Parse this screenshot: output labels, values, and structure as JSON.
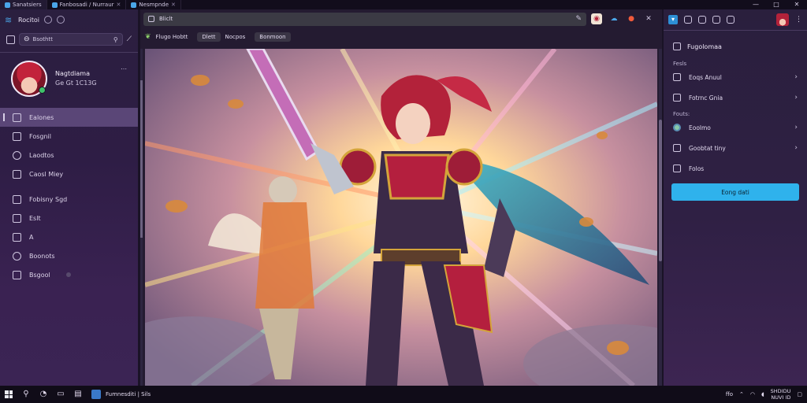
{
  "titlebar": {
    "tabs": [
      {
        "label": "Sanatsiers",
        "active": true
      },
      {
        "label": "Fanbosadi / Nurraur",
        "active": false
      },
      {
        "label": "Nesmpnde",
        "active": false
      }
    ],
    "controls": {
      "minimize": "—",
      "maximize": "□",
      "close": "✕"
    }
  },
  "sidebar": {
    "title": "Rocitoi",
    "search_placeholder": "Bsothtt",
    "profile": {
      "name": "Nagtdiama",
      "status": "Ge Gt 1C13G",
      "menu": "⋯"
    },
    "nav": [
      {
        "label": "Ealones",
        "icon": "book-icon",
        "active": true
      },
      {
        "label": "Fosgnil",
        "icon": "link-icon",
        "active": false
      },
      {
        "label": "Laodtos",
        "icon": "info-icon",
        "active": false
      },
      {
        "label": "Caosl Miey",
        "icon": "chat-icon",
        "active": false
      },
      {
        "label": "Fobisny Sgd",
        "icon": "pen-icon",
        "active": false
      },
      {
        "label": "Eslt",
        "icon": "file-icon",
        "active": false
      },
      {
        "label": "A",
        "icon": "tag-icon",
        "active": false
      },
      {
        "label": "Boonots",
        "icon": "gear-icon",
        "active": false
      },
      {
        "label": "Bsgool",
        "icon": "note-icon",
        "active": false
      }
    ]
  },
  "viewer": {
    "address": "Bliclt",
    "breadcrumbs": [
      "Flugo Hobtt",
      "Dlett",
      "Nocpos",
      "Bonmoon"
    ]
  },
  "rpanel": {
    "header": "Fugolomaa",
    "section1": "Fesls",
    "items1": [
      {
        "label": "Eoqs Anuul",
        "icon": "tag-icon"
      },
      {
        "label": "Fotrnc Gnia",
        "icon": "grid-icon"
      }
    ],
    "section2": "Fouts:",
    "items2": [
      {
        "label": "Eoolmo",
        "icon": "image-icon"
      },
      {
        "label": "Goobtat tiny",
        "icon": "edit-icon"
      },
      {
        "label": "Folos",
        "icon": "list-icon"
      }
    ],
    "button": "Eong dati"
  },
  "taskbar": {
    "app_label": "Fumnesditi | Sils",
    "tray_status": "ffo",
    "time": "SHDIDU",
    "date": "NUVI ID"
  },
  "colors": {
    "accent": "#2fb2ec",
    "active_nav": "#5a4677",
    "online": "#3fc36b"
  }
}
